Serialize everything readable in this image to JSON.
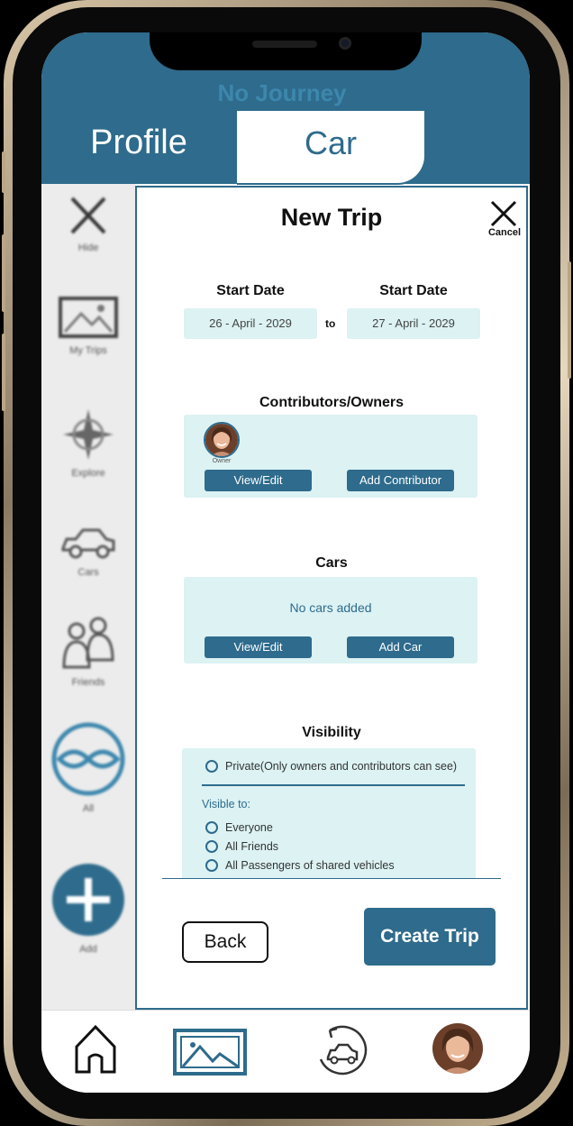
{
  "app": {
    "title": "No Journey"
  },
  "tabs": {
    "profile": "Profile",
    "car": "Car"
  },
  "sidebar": {
    "items": [
      {
        "label": "Hide",
        "icon": "close-icon"
      },
      {
        "label": "My Trips",
        "icon": "image-icon"
      },
      {
        "label": "Explore",
        "icon": "compass-icon"
      },
      {
        "label": "Cars",
        "icon": "car-icon"
      },
      {
        "label": "Friends",
        "icon": "friends-icon"
      },
      {
        "label": "All",
        "icon": "all-icon"
      },
      {
        "label": "Add",
        "icon": "plus-icon"
      }
    ]
  },
  "panel": {
    "title": "New Trip",
    "cancel_label": "Cancel",
    "start_date_label": "Start Date",
    "end_date_label": "Start Date",
    "start_date": "26 - April - 2029",
    "to_label": "to",
    "end_date": "27 - April - 2029",
    "contributors": {
      "heading": "Contributors/Owners",
      "owner_label": "Owner",
      "view_edit": "View/Edit",
      "add_contributor": "Add Contributor"
    },
    "cars": {
      "heading": "Cars",
      "empty_text": "No cars added",
      "view_edit": "View/Edit",
      "add_car": "Add Car"
    },
    "visibility": {
      "heading": "Visibility",
      "private_option": "Private(Only owners and contributors can see)",
      "visible_to_label": "Visible to:",
      "options": [
        "Everyone",
        "All Friends",
        "All Passengers of shared vehicles"
      ]
    },
    "back_label": "Back",
    "create_label": "Create Trip"
  },
  "bottom_nav": {
    "items": [
      "home-icon",
      "gallery-icon",
      "car-sync-icon",
      "profile-avatar"
    ]
  },
  "colors": {
    "primary": "#2e6b8c",
    "accent_light": "#dcf2f3",
    "title_faded": "#3d87ad"
  }
}
